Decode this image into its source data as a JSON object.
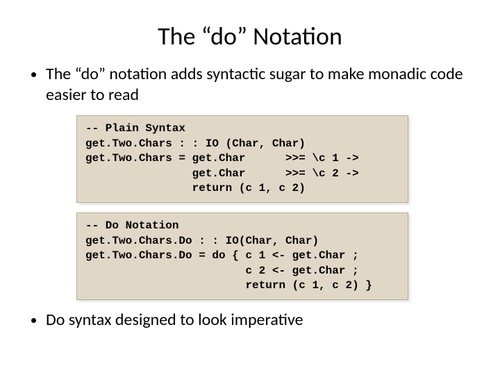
{
  "title": "The “do” Notation",
  "bullets": {
    "first": "The “do” notation adds syntactic sugar to make monadic code easier to read",
    "last": "Do syntax designed to look imperative"
  },
  "code": {
    "plain": "-- Plain Syntax\nget.Two.Chars : : IO (Char, Char)\nget.Two.Chars = get.Char      >>= \\c 1 ->\n                get.Char      >>= \\c 2 ->\n                return (c 1, c 2)",
    "doNotation": "-- Do Notation\nget.Two.Chars.Do : : IO(Char, Char)\nget.Two.Chars.Do = do { c 1 <- get.Char ;\n                        c 2 <- get.Char ;\n                        return (c 1, c 2) }"
  }
}
